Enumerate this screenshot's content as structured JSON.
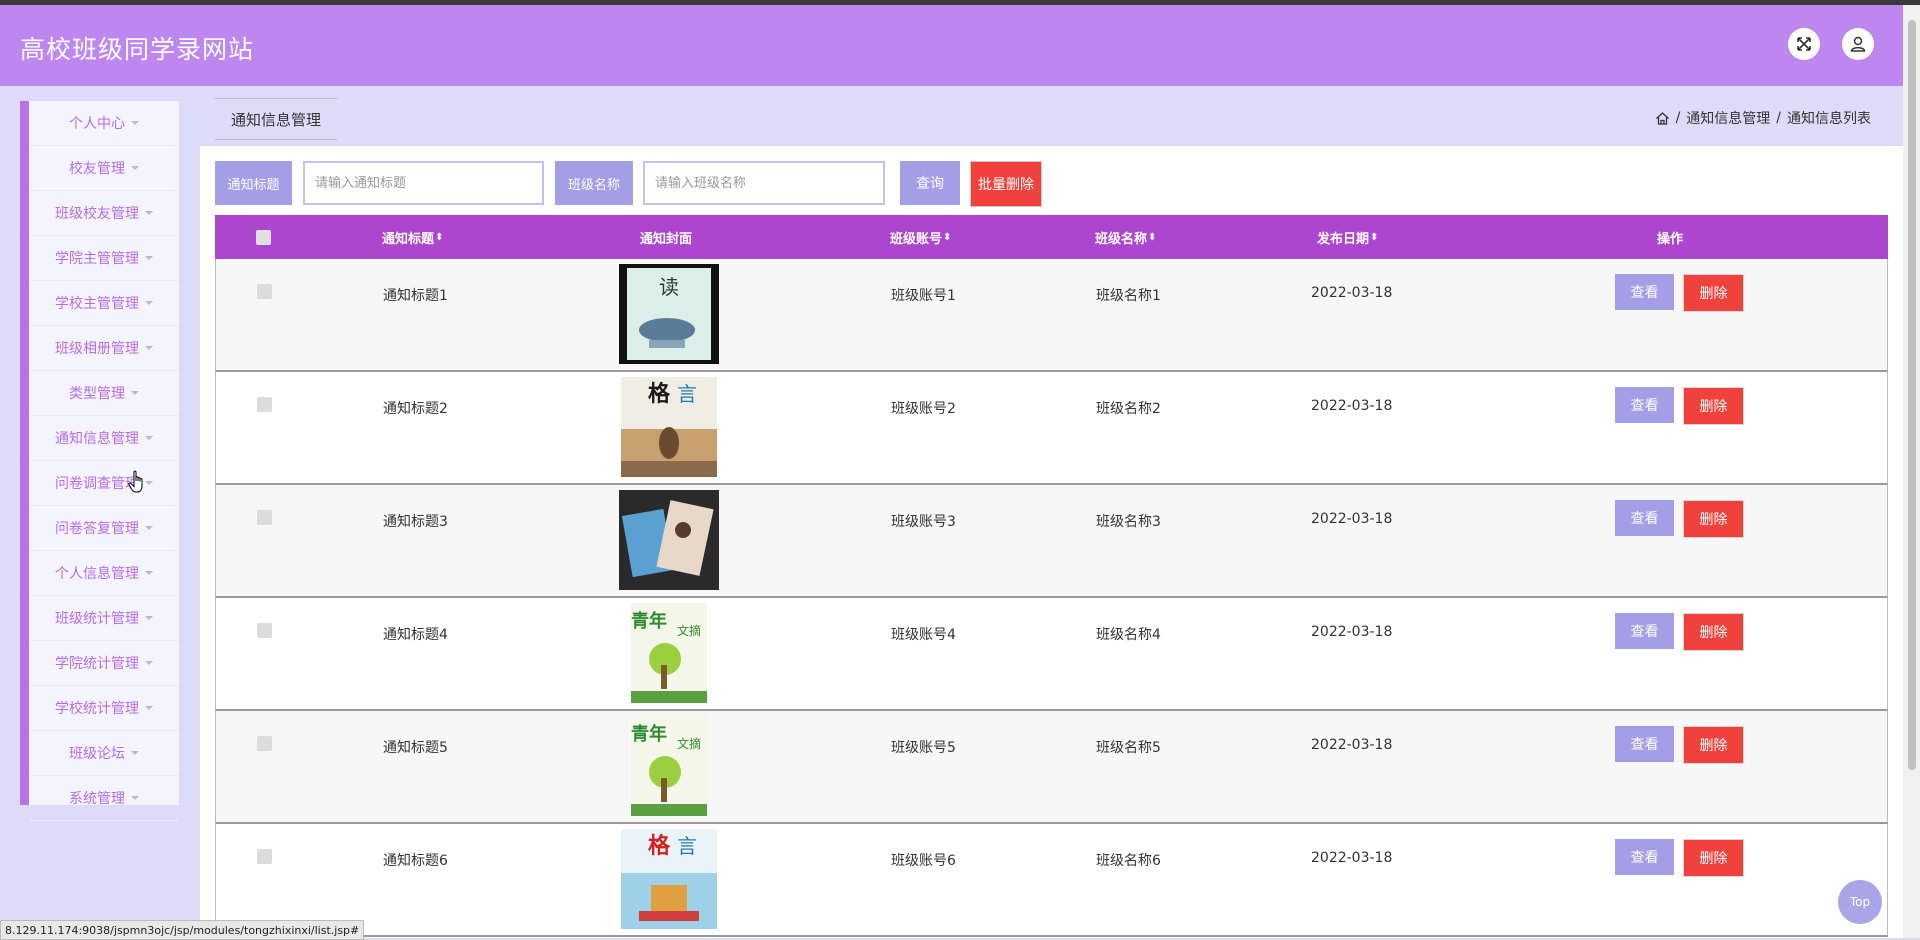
{
  "header": {
    "title": "高校班级同学录网站",
    "fullscreen_icon": "expand-icon",
    "user_icon": "user-icon"
  },
  "sidebar": {
    "items": [
      {
        "label": "个人中心"
      },
      {
        "label": "校友管理"
      },
      {
        "label": "班级校友管理"
      },
      {
        "label": "学院主管管理"
      },
      {
        "label": "学校主管管理"
      },
      {
        "label": "班级相册管理"
      },
      {
        "label": "类型管理"
      },
      {
        "label": "通知信息管理"
      },
      {
        "label": "问卷调查管理"
      },
      {
        "label": "问卷答复管理"
      },
      {
        "label": "个人信息管理"
      },
      {
        "label": "班级统计管理"
      },
      {
        "label": "学院统计管理"
      },
      {
        "label": "学校统计管理"
      },
      {
        "label": "班级论坛"
      },
      {
        "label": "系统管理"
      }
    ]
  },
  "tabs": {
    "active": "通知信息管理"
  },
  "breadcrumb": {
    "items": [
      "通知信息管理",
      "通知信息列表"
    ]
  },
  "search": {
    "title_label": "通知标题",
    "title_placeholder": "请输入通知标题",
    "class_label": "班级名称",
    "class_placeholder": "请输入班级名称",
    "query_button": "查询",
    "batch_delete_button": "批量删除"
  },
  "table": {
    "columns": [
      "通知标题",
      "通知封面",
      "班级账号",
      "班级名称",
      "发布日期",
      "操作"
    ],
    "sortable": [
      true,
      false,
      true,
      true,
      true,
      false
    ],
    "rows": [
      {
        "title": "通知标题1",
        "account": "班级账号1",
        "class_name": "班级名称1",
        "date": "2022-03-18",
        "cover": "magazine-cover-1"
      },
      {
        "title": "通知标题2",
        "account": "班级账号2",
        "class_name": "班级名称2",
        "date": "2022-03-18",
        "cover": "magazine-cover-2"
      },
      {
        "title": "通知标题3",
        "account": "班级账号3",
        "class_name": "班级名称3",
        "date": "2022-03-18",
        "cover": "magazine-cover-3"
      },
      {
        "title": "通知标题4",
        "account": "班级账号4",
        "class_name": "班级名称4",
        "date": "2022-03-18",
        "cover": "magazine-cover-4"
      },
      {
        "title": "通知标题5",
        "account": "班级账号5",
        "class_name": "班级名称5",
        "date": "2022-03-18",
        "cover": "magazine-cover-5"
      },
      {
        "title": "通知标题6",
        "account": "班级账号6",
        "class_name": "班级名称6",
        "date": "2022-03-18",
        "cover": "magazine-cover-6"
      }
    ],
    "view_label": "查看",
    "delete_label": "删除"
  },
  "top_button": "Top",
  "status_url": "8.129.11.174:9038/jspmn3ojc/jsp/modules/tongzhixinxi/list.jsp#",
  "colors": {
    "header": "#bd87ef",
    "sidebar_accent": "#b872e8",
    "table_header": "#ad46cf",
    "primary_button": "#a49ee6",
    "danger_button": "#f0413c",
    "page_bg": "#dcdcf8"
  }
}
